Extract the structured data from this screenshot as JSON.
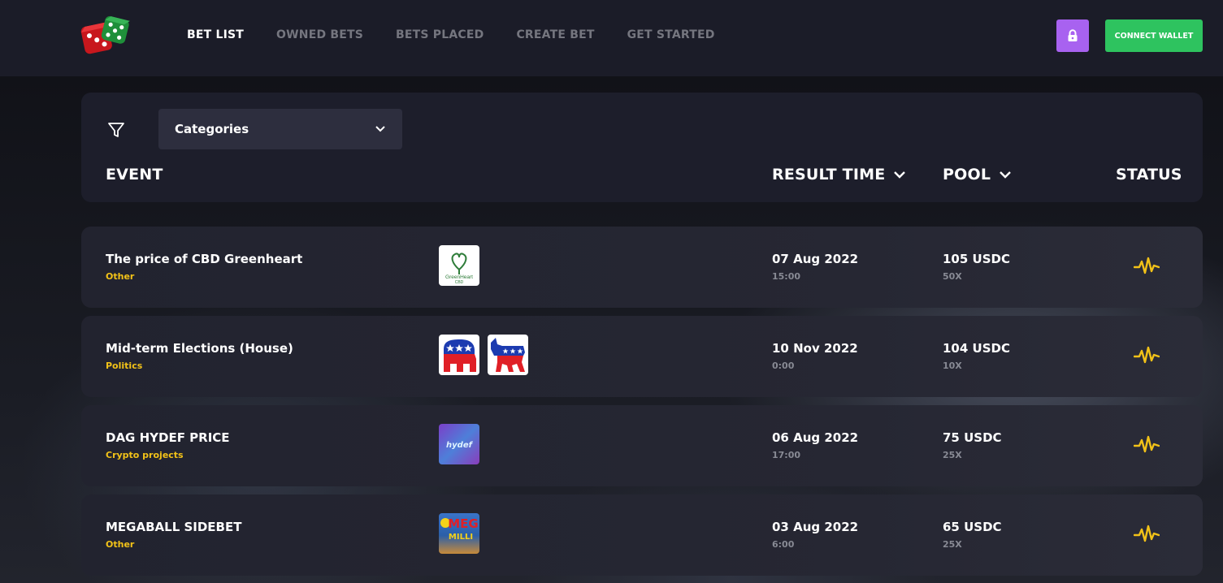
{
  "nav": {
    "items": [
      {
        "label": "BET LIST",
        "active": true
      },
      {
        "label": "OWNED BETS",
        "active": false
      },
      {
        "label": "BETS PLACED",
        "active": false
      },
      {
        "label": "CREATE BET",
        "active": false
      },
      {
        "label": "GET STARTED",
        "active": false
      }
    ],
    "lock_icon": "lock-icon",
    "connect_wallet_label": "CONNECT WALLET"
  },
  "filter": {
    "icon": "filter-icon",
    "categories_label": "Categories"
  },
  "table": {
    "columns": {
      "event": "EVENT",
      "result_time": "RESULT TIME",
      "pool": "POOL",
      "status": "STATUS"
    },
    "rows": [
      {
        "title": "The price of CBD Greenheart",
        "category": "Other",
        "images": [
          "greenheart-cbd-logo"
        ],
        "date": "07 Aug 2022",
        "time": "15:00",
        "pool": "105 USDC",
        "multiplier": "50X",
        "status_icon": "pulse-icon"
      },
      {
        "title": "Mid-term Elections (House)",
        "category": "Politics",
        "images": [
          "republican-elephant-logo",
          "democrat-donkey-logo"
        ],
        "date": "10 Nov 2022",
        "time": "0:00",
        "pool": "104 USDC",
        "multiplier": "10X",
        "status_icon": "pulse-icon"
      },
      {
        "title": "DAG HYDEF PRICE",
        "category": "Crypto projects",
        "images": [
          "hydef-logo"
        ],
        "date": "06 Aug 2022",
        "time": "17:00",
        "pool": "75 USDC",
        "multiplier": "25X",
        "status_icon": "pulse-icon"
      },
      {
        "title": "MEGABALL SIDEBET",
        "category": "Other",
        "images": [
          "mega-millions-logo"
        ],
        "date": "03 Aug 2022",
        "time": "6:00",
        "pool": "65 USDC",
        "multiplier": "25X",
        "status_icon": "pulse-icon"
      }
    ]
  },
  "logos": {
    "greenheart_text": "GreenHeart",
    "greenheart_sub": "CBD",
    "hydef_text": "hydef",
    "mega_text": "MEG",
    "millions_text": "MILLI"
  },
  "colors": {
    "accent_yellow": "#f2c218",
    "lock_purple": "#a862f0",
    "wallet_green": "#2ec35f",
    "panel": "#1d1e2b"
  }
}
